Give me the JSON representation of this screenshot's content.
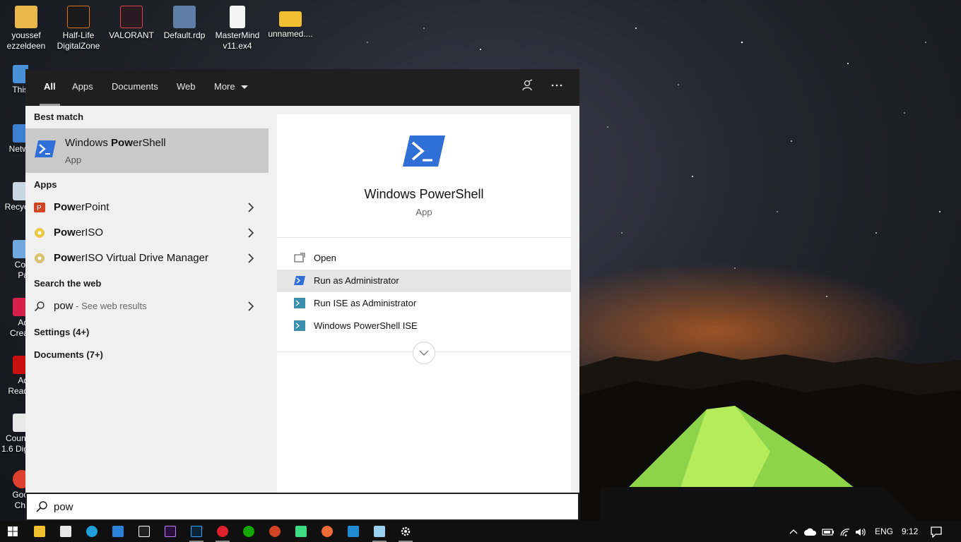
{
  "desktop": {
    "top_icons": [
      {
        "label_1": "youssef",
        "label_2": "ezzeldeen"
      },
      {
        "label_1": "Half-Life",
        "label_2": "DigitalZone"
      },
      {
        "label_1": "VALORANT",
        "label_2": ""
      },
      {
        "label_1": "Default.rdp",
        "label_2": ""
      },
      {
        "label_1": "MasterMind",
        "label_2": "v11.ex4"
      },
      {
        "label_1": "unnamed....",
        "label_2": ""
      }
    ],
    "left_icons": [
      {
        "label_1": "This",
        "label_2": ""
      },
      {
        "label_1": "Netw",
        "label_2": ""
      },
      {
        "label_1": "Recyc",
        "label_2": ""
      },
      {
        "label_1": "Cor",
        "label_2": "Pa"
      },
      {
        "label_1": "Ad",
        "label_2": "Crea"
      },
      {
        "label_1": "Ad",
        "label_2": "Read"
      },
      {
        "label_1": "Count",
        "label_2": "1.6 Dig"
      },
      {
        "label_1": "Goo",
        "label_2": "Chr"
      }
    ]
  },
  "search": {
    "tabs": [
      "All",
      "Apps",
      "Documents",
      "Web",
      "More"
    ],
    "best_match": {
      "heading": "Best match",
      "title_pre": "Windows ",
      "title_bold": "Pow",
      "title_post": "erShell",
      "subtitle": "App"
    },
    "apps": {
      "heading": "Apps",
      "items": [
        {
          "bold": "Pow",
          "rest": "erPoint"
        },
        {
          "bold": "Pow",
          "rest": "erISO"
        },
        {
          "bold": "Pow",
          "rest": "erISO Virtual Drive Manager"
        }
      ]
    },
    "web": {
      "heading": "Search the web",
      "query": "pow",
      "suffix": " - See web results"
    },
    "settings_heading": "Settings (4+)",
    "documents_heading": "Documents (7+)",
    "detail": {
      "title": "Windows PowerShell",
      "subtitle": "App",
      "actions": [
        "Open",
        "Run as Administrator",
        "Run ISE as Administrator",
        "Windows PowerShell ISE"
      ]
    },
    "input_value": "pow"
  },
  "taskbar": {
    "language": "ENG",
    "time": "9:12"
  },
  "colors": {
    "panel_bg": "#f0f0f0",
    "topbar_bg": "#1f1f1f",
    "best_match_bg": "#c9c9c9",
    "powershell_blue": "#2f6fd6",
    "taskbar_bg": "#101010"
  }
}
